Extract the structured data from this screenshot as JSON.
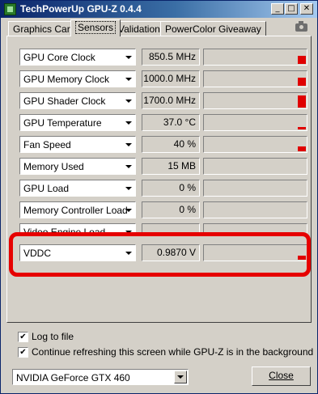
{
  "window": {
    "title": "TechPowerUp GPU-Z 0.4.4",
    "buttons": {
      "minimize": "_",
      "maximize": "□",
      "close": "✕"
    }
  },
  "tabs": [
    {
      "label": "Graphics Card",
      "active": false
    },
    {
      "label": "Sensors",
      "active": true
    },
    {
      "label": "Validation",
      "active": false
    },
    {
      "label": "PowerColor Giveaway",
      "active": false
    }
  ],
  "sensors": [
    {
      "name": "GPU Core Clock",
      "value": "850.5 MHz",
      "level": 0.5
    },
    {
      "name": "GPU Memory Clock",
      "value": "1000.0 MHz",
      "level": 0.5
    },
    {
      "name": "GPU Shader Clock",
      "value": "1700.0 MHz",
      "level": 0.8
    },
    {
      "name": "GPU Temperature",
      "value": "37.0 °C",
      "level": 0.15
    },
    {
      "name": "Fan Speed",
      "value": "40 %",
      "level": 0.3
    },
    {
      "name": "Memory Used",
      "value": "15 MB",
      "level": 0
    },
    {
      "name": "GPU Load",
      "value": "0 %",
      "level": 0
    },
    {
      "name": "Memory Controller Load",
      "value": "0 %",
      "level": 0
    },
    {
      "name": "Video Engine Load",
      "value": "",
      "level": 0
    },
    {
      "name": "VDDC",
      "value": "0.9870 V",
      "level": 0.25
    }
  ],
  "options": {
    "log_to_file": {
      "label": "Log to file",
      "checked": true
    },
    "continue_refresh": {
      "label": "Continue refreshing this screen while GPU-Z is in the background",
      "checked": true
    }
  },
  "footer": {
    "gpu_selected": "NVIDIA GeForce GTX 460",
    "close_label": "Close"
  },
  "colors": {
    "highlight": "#e60000",
    "graph_bar": "#e00000",
    "title_bar": "#0a246a"
  }
}
